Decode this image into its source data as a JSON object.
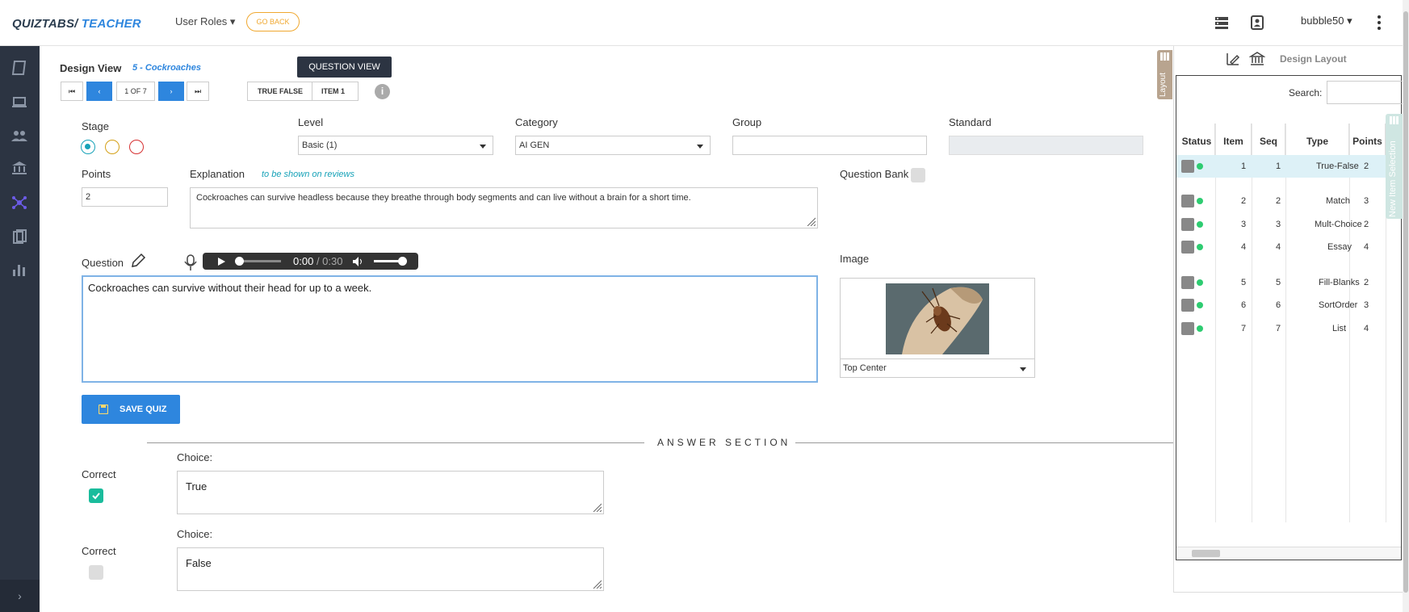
{
  "header": {
    "brand_part1": "QUIZTABS/",
    "brand_part2": "TEACHER",
    "user_roles": "User Roles ▾",
    "go_back": "GO BACK",
    "username": "bubble50 ▾"
  },
  "design": {
    "title": "Design View",
    "quiz_name": "5 - Cockroaches",
    "view_badge": "QUESTION VIEW",
    "position": "1 OF 7",
    "question_type": "TRUE FALSE",
    "item_label": "ITEM  1"
  },
  "form": {
    "stage_label": "Stage",
    "level_label": "Level",
    "level_value": "Basic (1)",
    "category_label": "Category",
    "category_value": "AI GEN",
    "group_label": "Group",
    "group_value": "",
    "standard_label": "Standard",
    "standard_value": "",
    "points_label": "Points",
    "points_value": "2",
    "explanation_label": "Explanation",
    "explanation_hint": "to be shown on reviews",
    "explanation_text": "Cockroaches can survive headless because they breathe through body segments and can live without a brain for a short time.",
    "question_bank_label": "Question Bank",
    "question_label": "Question",
    "audio_current": "0:00",
    "audio_duration": "/ 0:30",
    "question_text": "Cockroaches can survive without their head for up to a week.",
    "image_label": "Image",
    "image_position": "Top Center",
    "save_button": "SAVE QUIZ"
  },
  "answers": {
    "section_title": "ANSWER SECTION",
    "choices": [
      {
        "correct_label": "Correct",
        "choice_label": "Choice:",
        "text": "True",
        "correct": true
      },
      {
        "correct_label": "Correct",
        "choice_label": "Choice:",
        "text": "False",
        "correct": false
      }
    ]
  },
  "right_panel": {
    "layout_tab": "Layout",
    "title": "Design Layout",
    "search_label": "Search:",
    "new_selection_tab": "New Item Selection",
    "columns": [
      "Status",
      "Item",
      "Seq",
      "Type",
      "Points"
    ],
    "rows": [
      {
        "item": "1",
        "seq": "1",
        "type": "True-False",
        "points": "2"
      },
      {
        "item": "2",
        "seq": "2",
        "type": "Match",
        "points": "3"
      },
      {
        "item": "3",
        "seq": "3",
        "type": "Mult-Choice",
        "points": "2"
      },
      {
        "item": "4",
        "seq": "4",
        "type": "Essay",
        "points": "4"
      },
      {
        "item": "5",
        "seq": "5",
        "type": "Fill-Blanks",
        "points": "2"
      },
      {
        "item": "6",
        "seq": "6",
        "type": "SortOrder",
        "points": "3"
      },
      {
        "item": "7",
        "seq": "7",
        "type": "List",
        "points": "4"
      }
    ]
  },
  "colors": {
    "sidebar": "#2c3442",
    "accent_blue": "#2e86de",
    "go_back_orange": "#f0a830",
    "correct_green": "#1abc9c",
    "status_green": "#2ecc71"
  },
  "icons": {
    "top_right": [
      "server-icon",
      "contact-card-icon",
      "kebab-menu-icon"
    ],
    "sidebar": [
      "book-icon",
      "laptop-icon",
      "users-icon",
      "bank-icon",
      "network-icon",
      "documents-icon",
      "bar-chart-icon"
    ]
  }
}
